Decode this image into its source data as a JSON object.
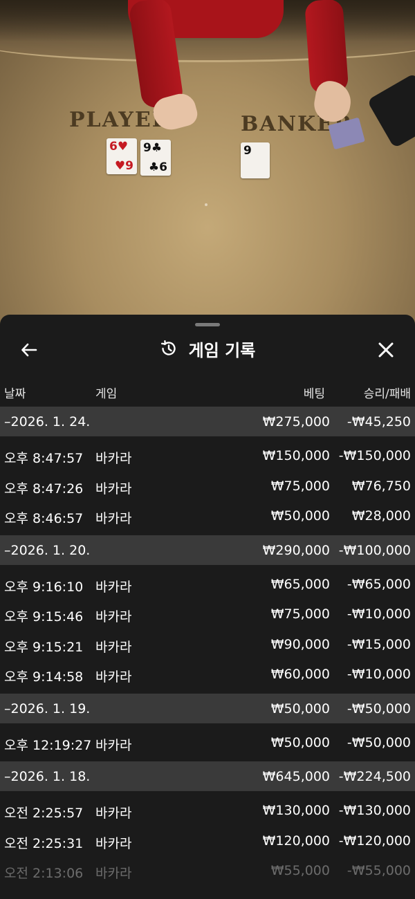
{
  "video": {
    "player_label": "PLAYER",
    "banker_label": "BANKER",
    "player_cards": [
      {
        "rank": "6",
        "suit": "♥",
        "rank2": "9",
        "color": "red"
      },
      {
        "rank": "9",
        "suit": "♣",
        "rank2": "6",
        "color": "black"
      }
    ],
    "banker_cards": [
      {
        "rank": "9",
        "suit": "",
        "color": "black"
      }
    ]
  },
  "sheet": {
    "title": "게임 기록",
    "icons": {
      "back": "arrow-left-icon",
      "history": "history-icon",
      "close": "close-icon"
    }
  },
  "columns": {
    "date": "날짜",
    "game": "게임",
    "bet": "베팅",
    "result": "승리/패배"
  },
  "groups": [
    {
      "date": "–2026. 1. 24.",
      "bet": "₩275,000",
      "result": "-₩45,250",
      "rows": [
        {
          "time": "오후 8:47:57",
          "game": "바카라",
          "bet": "₩150,000",
          "result": "-₩150,000"
        },
        {
          "time": "오후 8:47:26",
          "game": "바카라",
          "bet": "₩75,000",
          "result": "₩76,750"
        },
        {
          "time": "오후 8:46:57",
          "game": "바카라",
          "bet": "₩50,000",
          "result": "₩28,000"
        }
      ]
    },
    {
      "date": "–2026. 1. 20.",
      "bet": "₩290,000",
      "result": "-₩100,000",
      "rows": [
        {
          "time": "오후 9:16:10",
          "game": "바카라",
          "bet": "₩65,000",
          "result": "-₩65,000"
        },
        {
          "time": "오후 9:15:46",
          "game": "바카라",
          "bet": "₩75,000",
          "result": "-₩10,000"
        },
        {
          "time": "오후 9:15:21",
          "game": "바카라",
          "bet": "₩90,000",
          "result": "-₩15,000"
        },
        {
          "time": "오후 9:14:58",
          "game": "바카라",
          "bet": "₩60,000",
          "result": "-₩10,000"
        }
      ]
    },
    {
      "date": "–2026. 1. 19.",
      "bet": "₩50,000",
      "result": "-₩50,000",
      "rows": [
        {
          "time": "오후 12:19:27",
          "game": "바카라",
          "bet": "₩50,000",
          "result": "-₩50,000"
        }
      ]
    },
    {
      "date": "–2026. 1. 18.",
      "bet": "₩645,000",
      "result": "-₩224,500",
      "rows": [
        {
          "time": "오전 2:25:57",
          "game": "바카라",
          "bet": "₩130,000",
          "result": "-₩130,000"
        },
        {
          "time": "오전 2:25:31",
          "game": "바카라",
          "bet": "₩120,000",
          "result": "-₩120,000"
        },
        {
          "time": "오전 2:13:06",
          "game": "바카라",
          "bet": "₩55,000",
          "result": "-₩55,000"
        }
      ]
    }
  ]
}
